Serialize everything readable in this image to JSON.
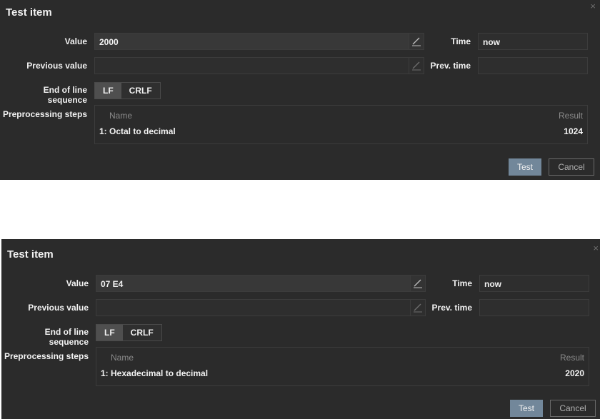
{
  "dialogs": [
    {
      "title": "Test item",
      "close_glyph": "×",
      "value_label": "Value",
      "value": "2000",
      "time_label": "Time",
      "time_value": "now",
      "previous_value_label": "Previous value",
      "previous_value": "",
      "prev_time_label": "Prev. time",
      "prev_time_value": "",
      "eol_label": "End of line sequence",
      "eol_options": [
        "LF",
        "CRLF"
      ],
      "eol_selected": "LF",
      "preprocessing_label": "Preprocessing steps",
      "table": {
        "col_name": "Name",
        "col_result": "Result",
        "rows": [
          {
            "step": "1:  Octal to decimal",
            "result": "1024"
          }
        ]
      },
      "test_button": "Test",
      "cancel_button": "Cancel"
    },
    {
      "title": "Test item",
      "close_glyph": "×",
      "value_label": "Value",
      "value": "07 E4",
      "time_label": "Time",
      "time_value": "now",
      "previous_value_label": "Previous value",
      "previous_value": "",
      "prev_time_label": "Prev. time",
      "prev_time_value": "",
      "eol_label": "End of line sequence",
      "eol_options": [
        "LF",
        "CRLF"
      ],
      "eol_selected": "LF",
      "preprocessing_label": "Preprocessing steps",
      "table": {
        "col_name": "Name",
        "col_result": "Result",
        "rows": [
          {
            "step": "1:  Hexadecimal to decimal",
            "result": "2020"
          }
        ]
      },
      "test_button": "Test",
      "cancel_button": "Cancel"
    }
  ],
  "colors": {
    "dialog_bg": "#2b2b2b",
    "test_button_bg": "#72879a",
    "text": "#f2f2f2",
    "muted": "#8a8a8a"
  }
}
